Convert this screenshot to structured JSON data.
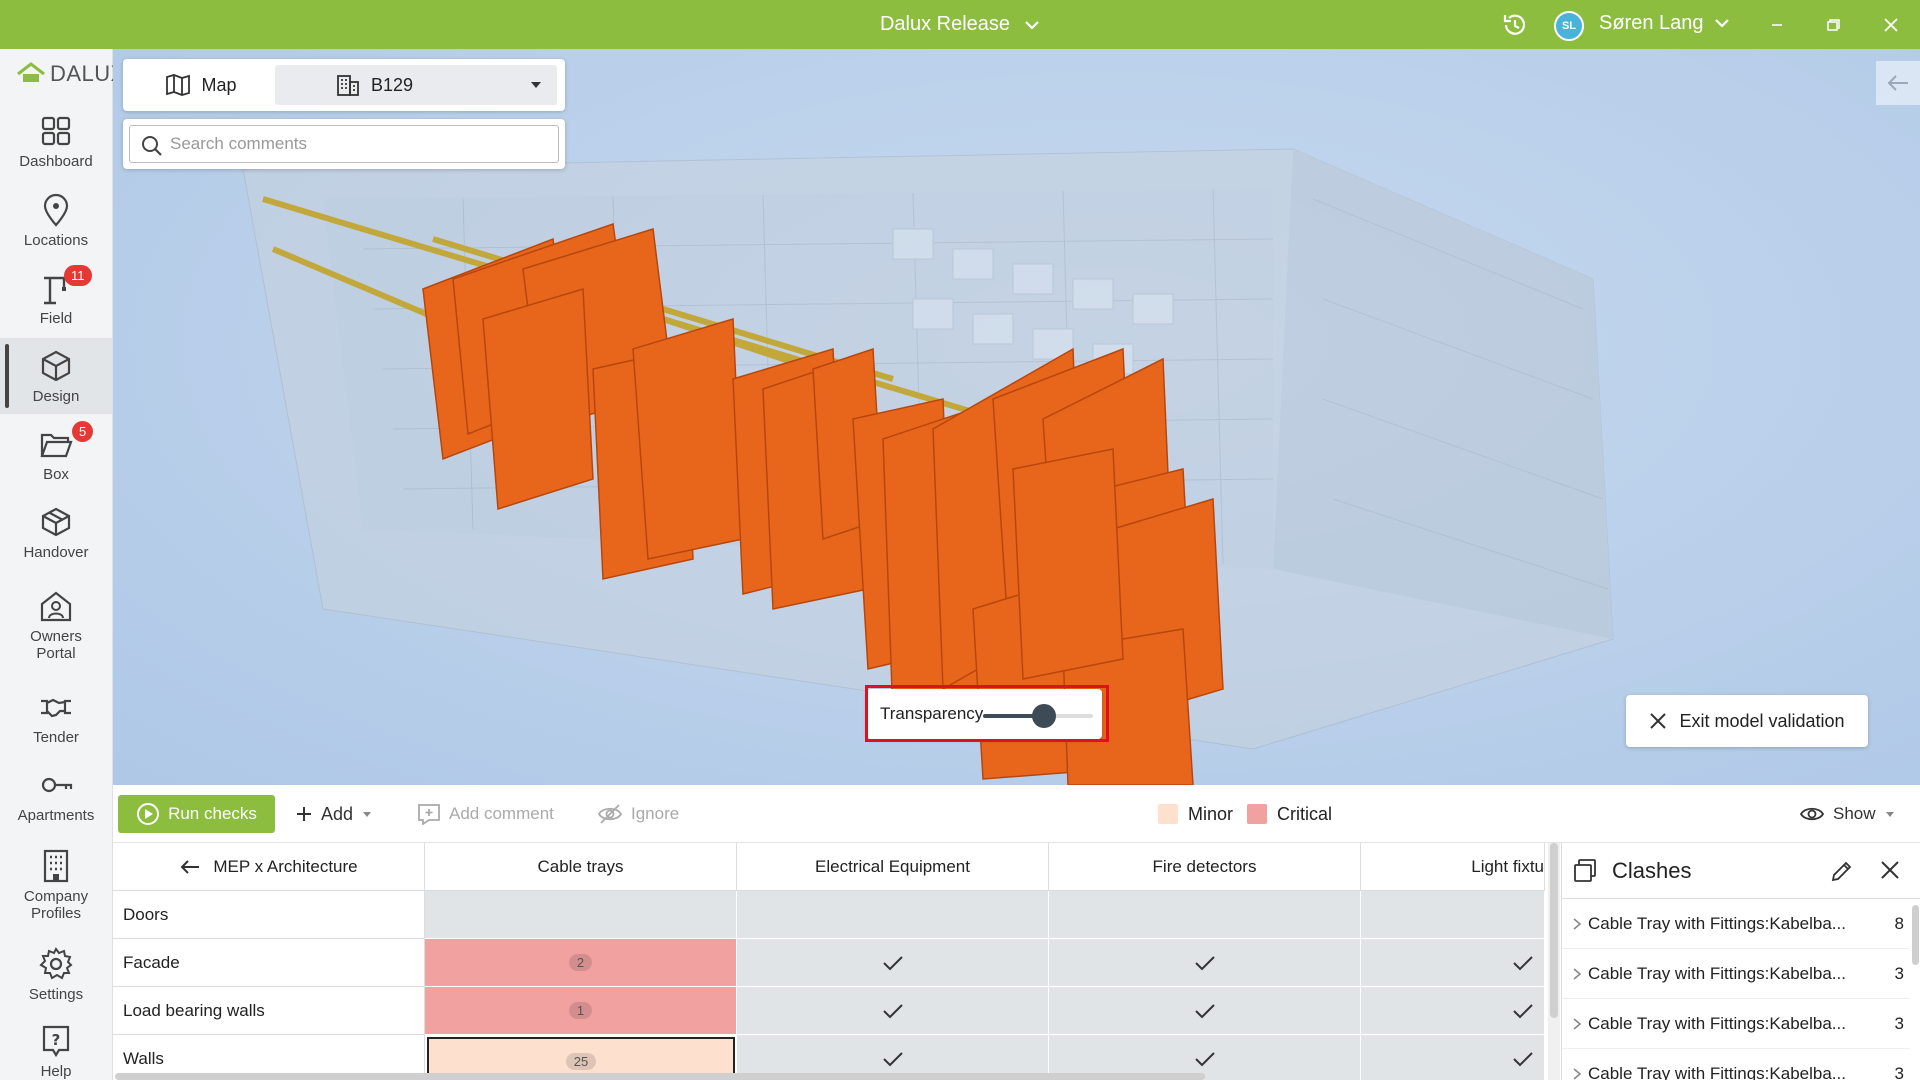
{
  "titlebar": {
    "app_title": "Dalux Release",
    "user_initials": "SL",
    "user_name": "Søren Lang"
  },
  "sidebar": {
    "logo_text": "DALUX",
    "items": [
      {
        "label": "Dashboard",
        "icon": "grid-icon"
      },
      {
        "label": "Locations",
        "icon": "map-pin-icon"
      },
      {
        "label": "Field",
        "icon": "crane-icon",
        "badge": "11"
      },
      {
        "label": "Design",
        "icon": "cube-icon",
        "active": true
      },
      {
        "label": "Box",
        "icon": "folder-icon",
        "badge": "5"
      },
      {
        "label": "Handover",
        "icon": "box-icon"
      },
      {
        "label": "Owners Portal",
        "icon": "house-user-icon"
      },
      {
        "label": "Tender",
        "icon": "handshake-icon"
      },
      {
        "label": "Apartments",
        "icon": "key-icon"
      },
      {
        "label": "Company Profiles",
        "icon": "building-icon"
      },
      {
        "label": "Settings",
        "icon": "gear-icon"
      },
      {
        "label": "Help",
        "icon": "help-icon"
      }
    ]
  },
  "viewport": {
    "map_tab_label": "Map",
    "building_selected": "B129",
    "search_placeholder": "Search comments",
    "transparency_label": "Transparency",
    "transparency_value": 0.55,
    "exit_label": "Exit model validation"
  },
  "toolbar": {
    "run_label": "Run checks",
    "add_label": "Add",
    "add_comment_label": "Add comment",
    "ignore_label": "Ignore",
    "legend_minor": "Minor",
    "legend_critical": "Critical",
    "minor_color": "#fde0cd",
    "critical_color": "#f2a1a1",
    "show_label": "Show"
  },
  "matrix": {
    "title": "MEP x Architecture",
    "columns": [
      "Cable trays",
      "Electrical Equipment",
      "Fire detectors",
      "Light fixtu"
    ],
    "rows": [
      {
        "label": "Doors",
        "cells": [
          "",
          "",
          "",
          ""
        ]
      },
      {
        "label": "Facade",
        "cells": [
          "2",
          "✓",
          "✓",
          "✓"
        ]
      },
      {
        "label": "Load bearing walls",
        "cells": [
          "1",
          "✓",
          "✓",
          "✓"
        ]
      },
      {
        "label": "Walls",
        "cells": [
          "25",
          "✓",
          "✓",
          "✓"
        ]
      }
    ]
  },
  "clashes": {
    "title": "Clashes",
    "items": [
      {
        "name": "Cable Tray with Fittings:Kabelba...",
        "count": "8"
      },
      {
        "name": "Cable Tray with Fittings:Kabelba...",
        "count": "3"
      },
      {
        "name": "Cable Tray with Fittings:Kabelba...",
        "count": "3"
      },
      {
        "name": "Cable Tray with Fittings:Kabelba...",
        "count": "3"
      }
    ]
  }
}
